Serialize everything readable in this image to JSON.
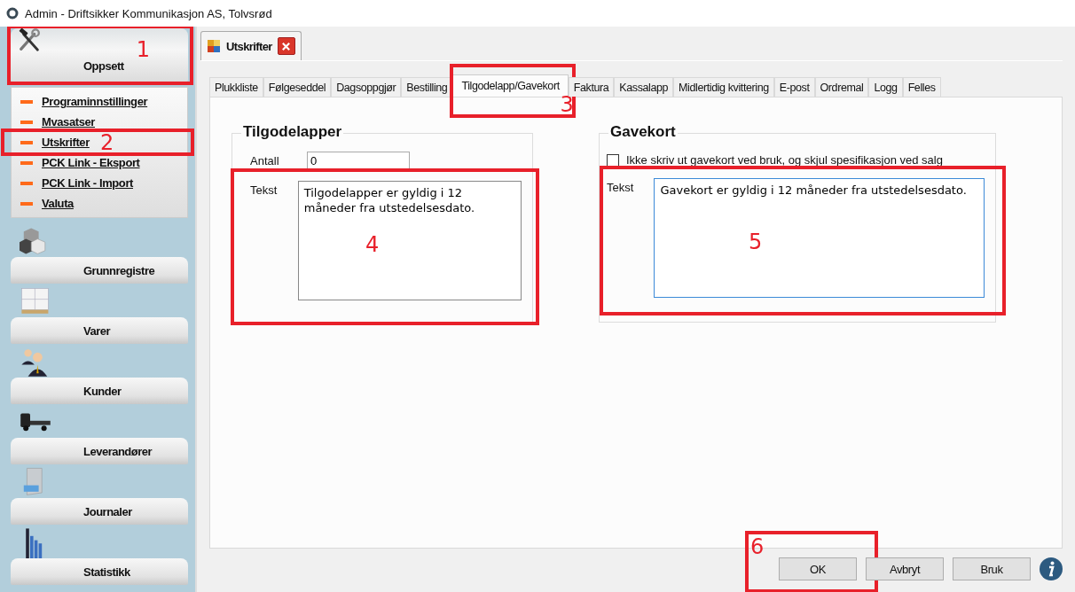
{
  "window": {
    "title": "Admin - Driftsikker Kommunikasjon AS, Tolvsrød"
  },
  "sidebar": {
    "sections": [
      {
        "label": "Oppsett",
        "expanded": true,
        "annotation": "1",
        "items": [
          {
            "label": "Programinnstillinger"
          },
          {
            "label": "Mvasatser"
          },
          {
            "label": "Utskrifter",
            "annotation": "2"
          },
          {
            "label": "PCK Link - Eksport"
          },
          {
            "label": "PCK Link - Import"
          },
          {
            "label": "Valuta"
          }
        ]
      },
      {
        "label": "Grunnregistre",
        "expanded": false
      },
      {
        "label": "Varer",
        "expanded": false
      },
      {
        "label": "Kunder",
        "expanded": false
      },
      {
        "label": "Leverandører",
        "expanded": false
      },
      {
        "label": "Journaler",
        "expanded": false
      },
      {
        "label": "Statistikk",
        "expanded": false
      }
    ]
  },
  "document_tab": {
    "label": "Utskrifter"
  },
  "tabs": [
    {
      "label": "Plukkliste",
      "selected": false
    },
    {
      "label": "Følgeseddel",
      "selected": false
    },
    {
      "label": "Dagsoppgjør",
      "selected": false
    },
    {
      "label": "Bestilling",
      "selected": false
    },
    {
      "label": "Tilgodelapp/Gavekort",
      "selected": true,
      "annotation": "3"
    },
    {
      "label": "Faktura",
      "selected": false
    },
    {
      "label": "Kassalapp",
      "selected": false
    },
    {
      "label": "Midlertidig kvittering",
      "selected": false
    },
    {
      "label": "E-post",
      "selected": false
    },
    {
      "label": "Ordremal",
      "selected": false
    },
    {
      "label": "Logg",
      "selected": false
    },
    {
      "label": "Felles",
      "selected": false
    }
  ],
  "tilgodelapper": {
    "title": "Tilgodelapper",
    "count_label": "Antall",
    "count_value": "0",
    "text_label": "Tekst",
    "text_value": "Tilgodelapper er gyldig i 12 måneder fra utstedelsesdato.",
    "focused": false,
    "annotation": "4"
  },
  "gavekort": {
    "title": "Gavekort",
    "checkbox": {
      "label": "Ikke skriv ut gavekort ved bruk, og skjul spesifikasjon ved salg",
      "checked": false
    },
    "text_label": "Tekst",
    "text_value": "Gavekort er gyldig i 12 måneder fra utstedelsesdato.",
    "focused": true,
    "annotation": "5"
  },
  "buttons": [
    {
      "label": "OK",
      "annotation": "6"
    },
    {
      "label": "Avbryt"
    },
    {
      "label": "Bruk"
    }
  ]
}
